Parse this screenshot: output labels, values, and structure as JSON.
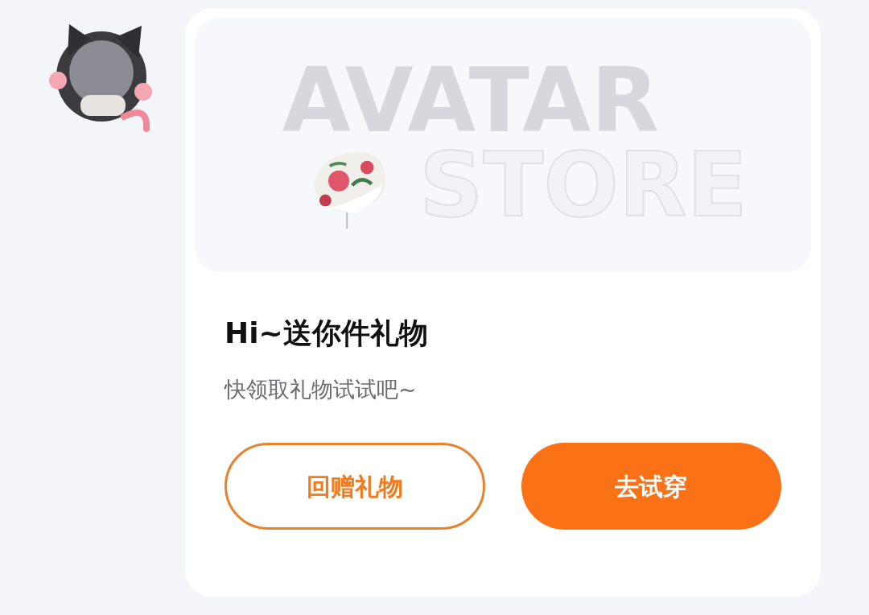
{
  "banner": {
    "watermark_lines": [
      "AVATAR",
      "STORE"
    ]
  },
  "title": "Hi~送你件礼物",
  "subtitle": "快领取礼物试试吧~",
  "buttons": [
    {
      "label": "回赠礼物",
      "kind": "outline"
    },
    {
      "label": "去试穿",
      "kind": "filled"
    }
  ]
}
